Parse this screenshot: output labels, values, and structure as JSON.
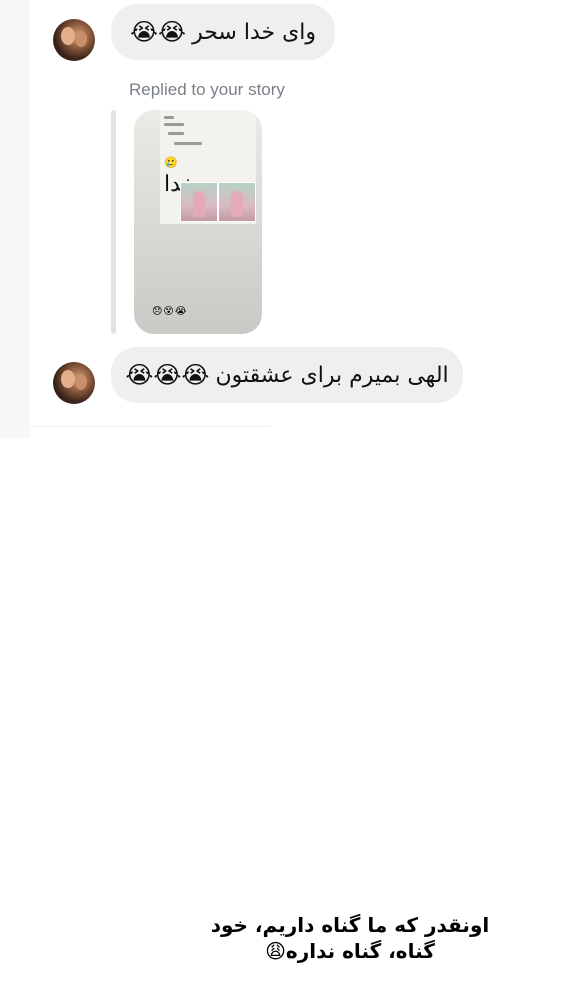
{
  "thread": {
    "messages": [
      {
        "text": "وای خدا سحر",
        "emojis": "😭😭",
        "avatar_icon": "profile-photo"
      },
      {
        "reply_label": "Replied to your story",
        "story_preview": {
          "big_text": "خدا",
          "small_emoji": "🥲",
          "reaction_emojis": "😞😵😭"
        }
      },
      {
        "text": "الهی بمیرم برای عشقتون",
        "emojis": "😭😭😭",
        "avatar_icon": "profile-photo"
      }
    ]
  },
  "caption": {
    "line1": "اونقدر که ما گناه داریم، خود",
    "line2": "گناه، گناه نداره😩"
  },
  "colors": {
    "bubble_bg": "#efefef",
    "reply_label": "#7a7f87",
    "background": "#ffffff"
  }
}
